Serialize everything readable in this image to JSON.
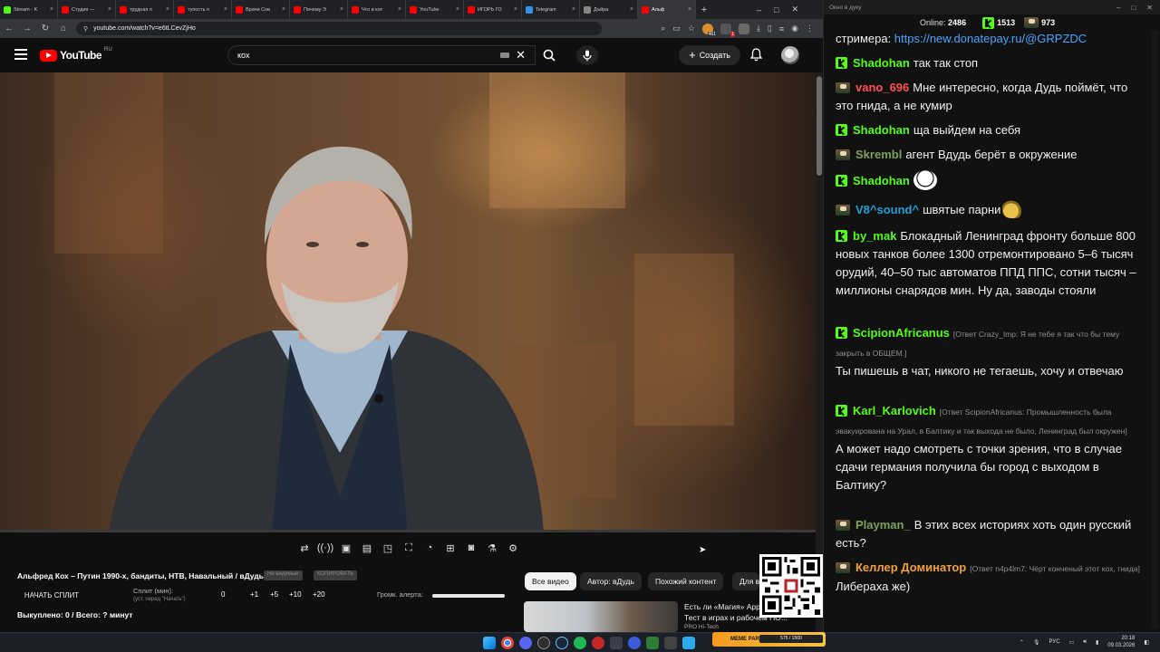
{
  "browser": {
    "tabs": [
      {
        "label": "Stream - K",
        "color": "#53fc18"
      },
      {
        "label": "Студия —",
        "color": "#ff0000"
      },
      {
        "label": "трудная п",
        "color": "#ff0000"
      },
      {
        "label": "тупость п",
        "color": "#ff0000"
      },
      {
        "label": "Врачи Сов",
        "color": "#ff0000"
      },
      {
        "label": "Почему Э",
        "color": "#ff0000"
      },
      {
        "label": "Что в кот",
        "color": "#ff0000"
      },
      {
        "label": "YouTube",
        "color": "#ff0000"
      },
      {
        "label": "ИГОРЬ ГО",
        "color": "#ff0000"
      },
      {
        "label": "Telegram",
        "color": "#3390ec"
      },
      {
        "label": "Дъйра",
        "color": "#888888"
      },
      {
        "label": "Альф",
        "color": "#ff0000"
      }
    ],
    "new_tab": "+",
    "url": "youtube.com/watch?v=e6tLCevZjHo",
    "ext_badges": {
      "a": "461",
      "b": "1"
    }
  },
  "youtube": {
    "logo_text": "YouTube",
    "logo_region": "RU",
    "search_value": "кох",
    "create_label": "Создать",
    "video_title": "Альфред Кох – Путин 1990-х, бандиты, НТВ, Навальный / вДудь",
    "chip_seen": "Не видимые",
    "chip_copy": "КОПИРОВАТЬ",
    "split_button": "НАЧАТЬ СПЛИТ",
    "split_label": "Сплит (мин):",
    "split_sub": "(уст. перед \"Начать\")",
    "split_values": [
      "0",
      "+1",
      "+5",
      "+10",
      "+20"
    ],
    "alert_label": "Громк. алерта:",
    "alert_level": 1.0,
    "bought": "Выкуплено: 0 / Всего: ? минут",
    "filter_chips": [
      "Все видео",
      "Автор: вДудь",
      "Похожий контент",
      "Для в"
    ],
    "rec_title_line1": "Есть ли «Магия» Арр",
    "rec_title_line2": "Тест в играх и рабочем ПО...",
    "rec_channel": "PRO Hi-Tech"
  },
  "chat": {
    "window_title": "Окно в дуку",
    "online_label": "Online:",
    "online_count": "2486",
    "kick_count": "1513",
    "twitch_count": "973",
    "messages": [
      {
        "platform": "none",
        "user": "",
        "user_color": "#efefef",
        "reply": "",
        "text": "стримера: ",
        "link": "https://new.donatepay.ru/@GRPZDC"
      },
      {
        "platform": "kick",
        "user": "Shadohan",
        "user_color": "#53fc18",
        "reply": "",
        "text": "так так стоп"
      },
      {
        "platform": "twitch",
        "user": "vano_696",
        "user_color": "#ff4f4f",
        "reply": "",
        "text": "Мне интересно, когда Дудь поймёт, что это гнида, а не кумир"
      },
      {
        "platform": "kick",
        "user": "Shadohan",
        "user_color": "#53fc18",
        "reply": "",
        "text": "ща выйдем на себя"
      },
      {
        "platform": "twitch",
        "user": "Skrembl",
        "user_color": "#7da05a",
        "reply": "",
        "text": "агент Вдудь берёт в окружение"
      },
      {
        "platform": "kick",
        "user": "Shadohan",
        "user_color": "#53fc18",
        "reply": "",
        "text": ""
      },
      {
        "platform": "twitch",
        "user": "V8^sound^",
        "user_color": "#1e9fd6",
        "reply": "",
        "text": "швятые парни"
      },
      {
        "platform": "kick",
        "user": "by_mak",
        "user_color": "#53fc18",
        "reply": "",
        "text": "Блокадный Ленинград фронту больше 800 новых танков более 1300 отремонтировано 5–6 тысяч орудий, 40–50 тыс автоматов ППД ППС, сотни тысяч – миллионы снарядов мин. Ну да, заводы стояли"
      },
      {
        "platform": "kick",
        "user": "ScipionAfricanus",
        "user_color": "#53fc18",
        "reply": "[Ответ Crazy_Imp: Я не тебе я так что бы тему закрыть в ОБЩЕМ.]",
        "text": "Ты пишешь в чат, никого не тегаешь, хочу и отвечаю"
      },
      {
        "platform": "kick",
        "user": "Karl_Karlovich",
        "user_color": "#53fc18",
        "reply": "[Ответ ScipionAfricanus: Промышленность была эвакуирована на Урал, в Балтику и так выхода не было, Ленинград был окружен]",
        "text": "А может надо смотреть с точки зрения, что в случае сдачи германия получила бы город с выходом в Балтику?"
      },
      {
        "platform": "twitch",
        "user": "Playman_",
        "user_color": "#7da05a",
        "reply": "",
        "text": "В этих всех историях хоть один русский есть?"
      },
      {
        "platform": "twitch",
        "user": "Келлер Доминатор",
        "user_color": "#f0a23c",
        "reply": "[Ответ n4p4lm7: Чёрт конченый этот кох, гнида]",
        "text": "Либераха же)"
      }
    ]
  },
  "taskbar": {
    "meme_label": "MEME PARTY",
    "meme_progress": "575 / 1500",
    "lang": "РУС",
    "time": "20:18",
    "date": "09.03.2026"
  }
}
